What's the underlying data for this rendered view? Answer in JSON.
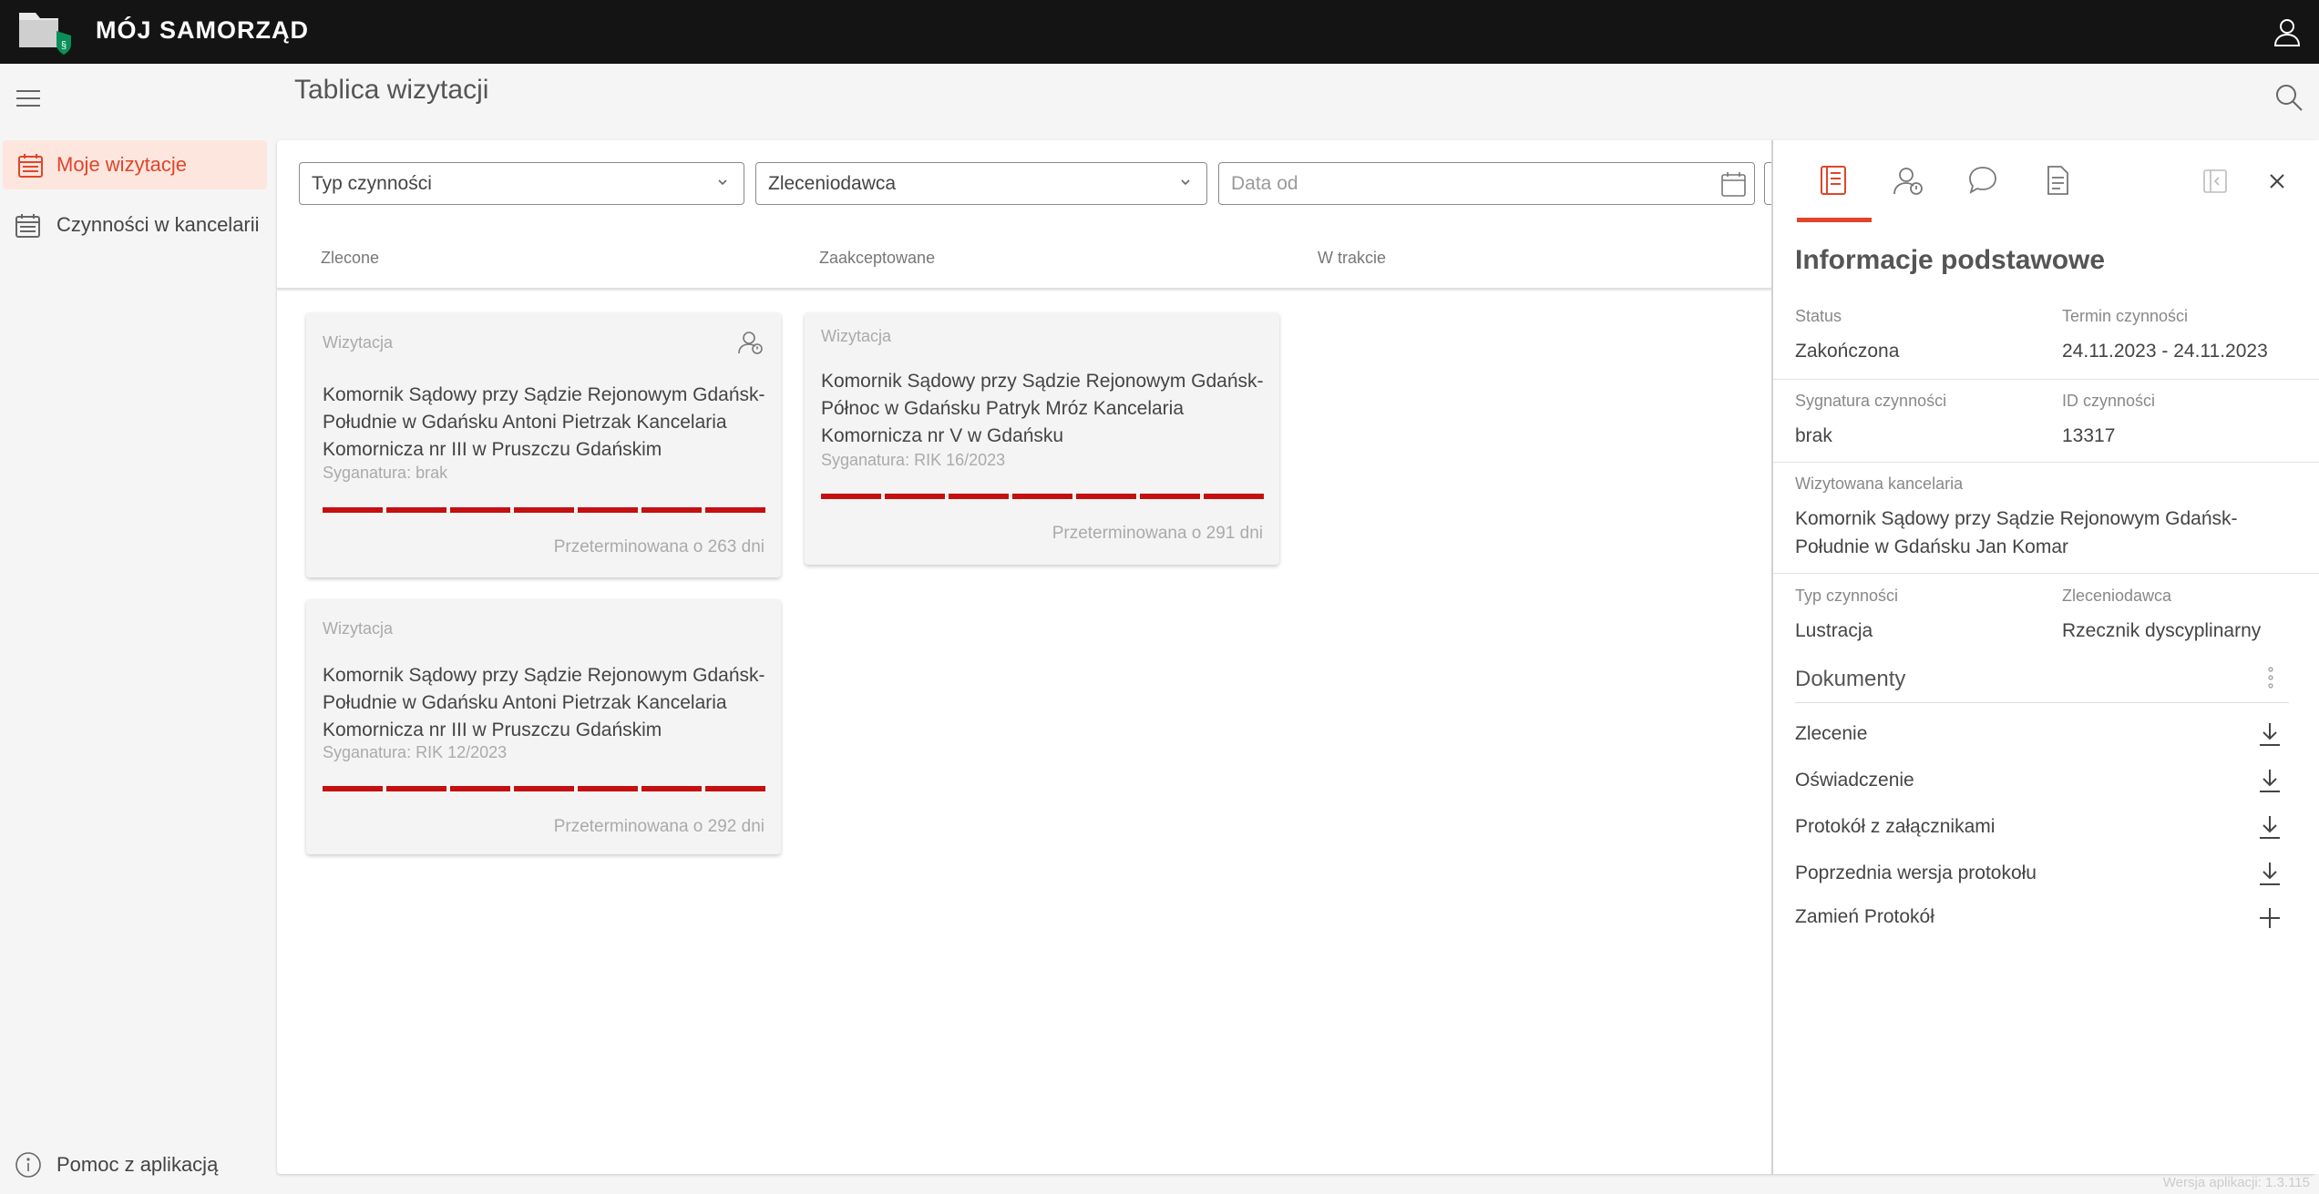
{
  "app": {
    "title": "MÓJ SAMORZĄD"
  },
  "sidebar": {
    "items": [
      {
        "label": "Moje wizytacje",
        "active": true
      },
      {
        "label": "Czynności w kancelarii",
        "active": false
      }
    ],
    "help_label": "Pomoc z aplikacją"
  },
  "page": {
    "title": "Tablica wizytacji"
  },
  "filters": {
    "activity_type": "Typ czynności",
    "client": "Zleceniodawca",
    "date_from_placeholder": "Data od"
  },
  "columns": [
    "Zlecone",
    "Zaakceptowane",
    "W trakcie"
  ],
  "cards": [
    {
      "type": "Wizytacja",
      "title": "Komornik Sądowy przy Sądzie Rejonowym Gdańsk-Południe w Gdańsku Antoni Pietrzak Kancelaria Komornicza nr III w Pruszczu Gdańskim",
      "signature": "Syganatura: brak",
      "overdue": "Przeterminowana o 263 dni"
    },
    {
      "type": "Wizytacja",
      "title": "Komornik Sądowy przy Sądzie Rejonowym Gdańsk-Południe w Gdańsku Antoni Pietrzak Kancelaria Komornicza nr III w Pruszczu Gdańskim",
      "signature": "Syganatura: RIK 12/2023",
      "overdue": "Przeterminowana o 292 dni"
    },
    {
      "type": "Wizytacja",
      "title": "Komornik Sądowy przy Sądzie Rejonowym Gdańsk-Północ w Gdańsku Patryk Mróz Kancelaria Komornicza nr V w Gdańsku",
      "signature": "Syganatura: RIK 16/2023",
      "overdue": "Przeterminowana o 291 dni"
    }
  ],
  "panel": {
    "heading": "Informacje podstawowe",
    "status_label": "Status",
    "status_value": "Zakończona",
    "term_label": "Termin czynności",
    "term_value": "24.11.2023 - 24.11.2023",
    "signature_label": "Sygnatura czynności",
    "signature_value": "brak",
    "id_label": "ID czynności",
    "id_value": "13317",
    "office_label": "Wizytowana kancelaria",
    "office_value": "Komornik Sądowy przy Sądzie Rejonowym Gdańsk-Południe w Gdańsku Jan Komar",
    "type_label": "Typ czynności",
    "type_value": "Lustracja",
    "client_label": "Zleceniodawca",
    "client_value": "Rzecznik dyscyplinarny",
    "documents_heading": "Dokumenty",
    "documents": [
      "Zlecenie",
      "Oświadczenie",
      "Protokół z załącznikami",
      "Poprzednia wersja protokołu"
    ],
    "replace_label": "Zamień Protokół"
  },
  "version": "Wersja aplikacji: 1.3.115",
  "colors": {
    "accent": "#e0452a",
    "progress": "#c41010",
    "topbar": "#141414"
  },
  "icons": [
    "logo-icon",
    "user-icon",
    "menu-icon",
    "calendar-icon",
    "info-icon",
    "search-icon",
    "chevron-down-icon",
    "contact-icon",
    "details-icon",
    "chat-icon",
    "document-icon",
    "collapse-icon",
    "close-icon",
    "kebab-icon",
    "download-icon",
    "plus-icon"
  ]
}
